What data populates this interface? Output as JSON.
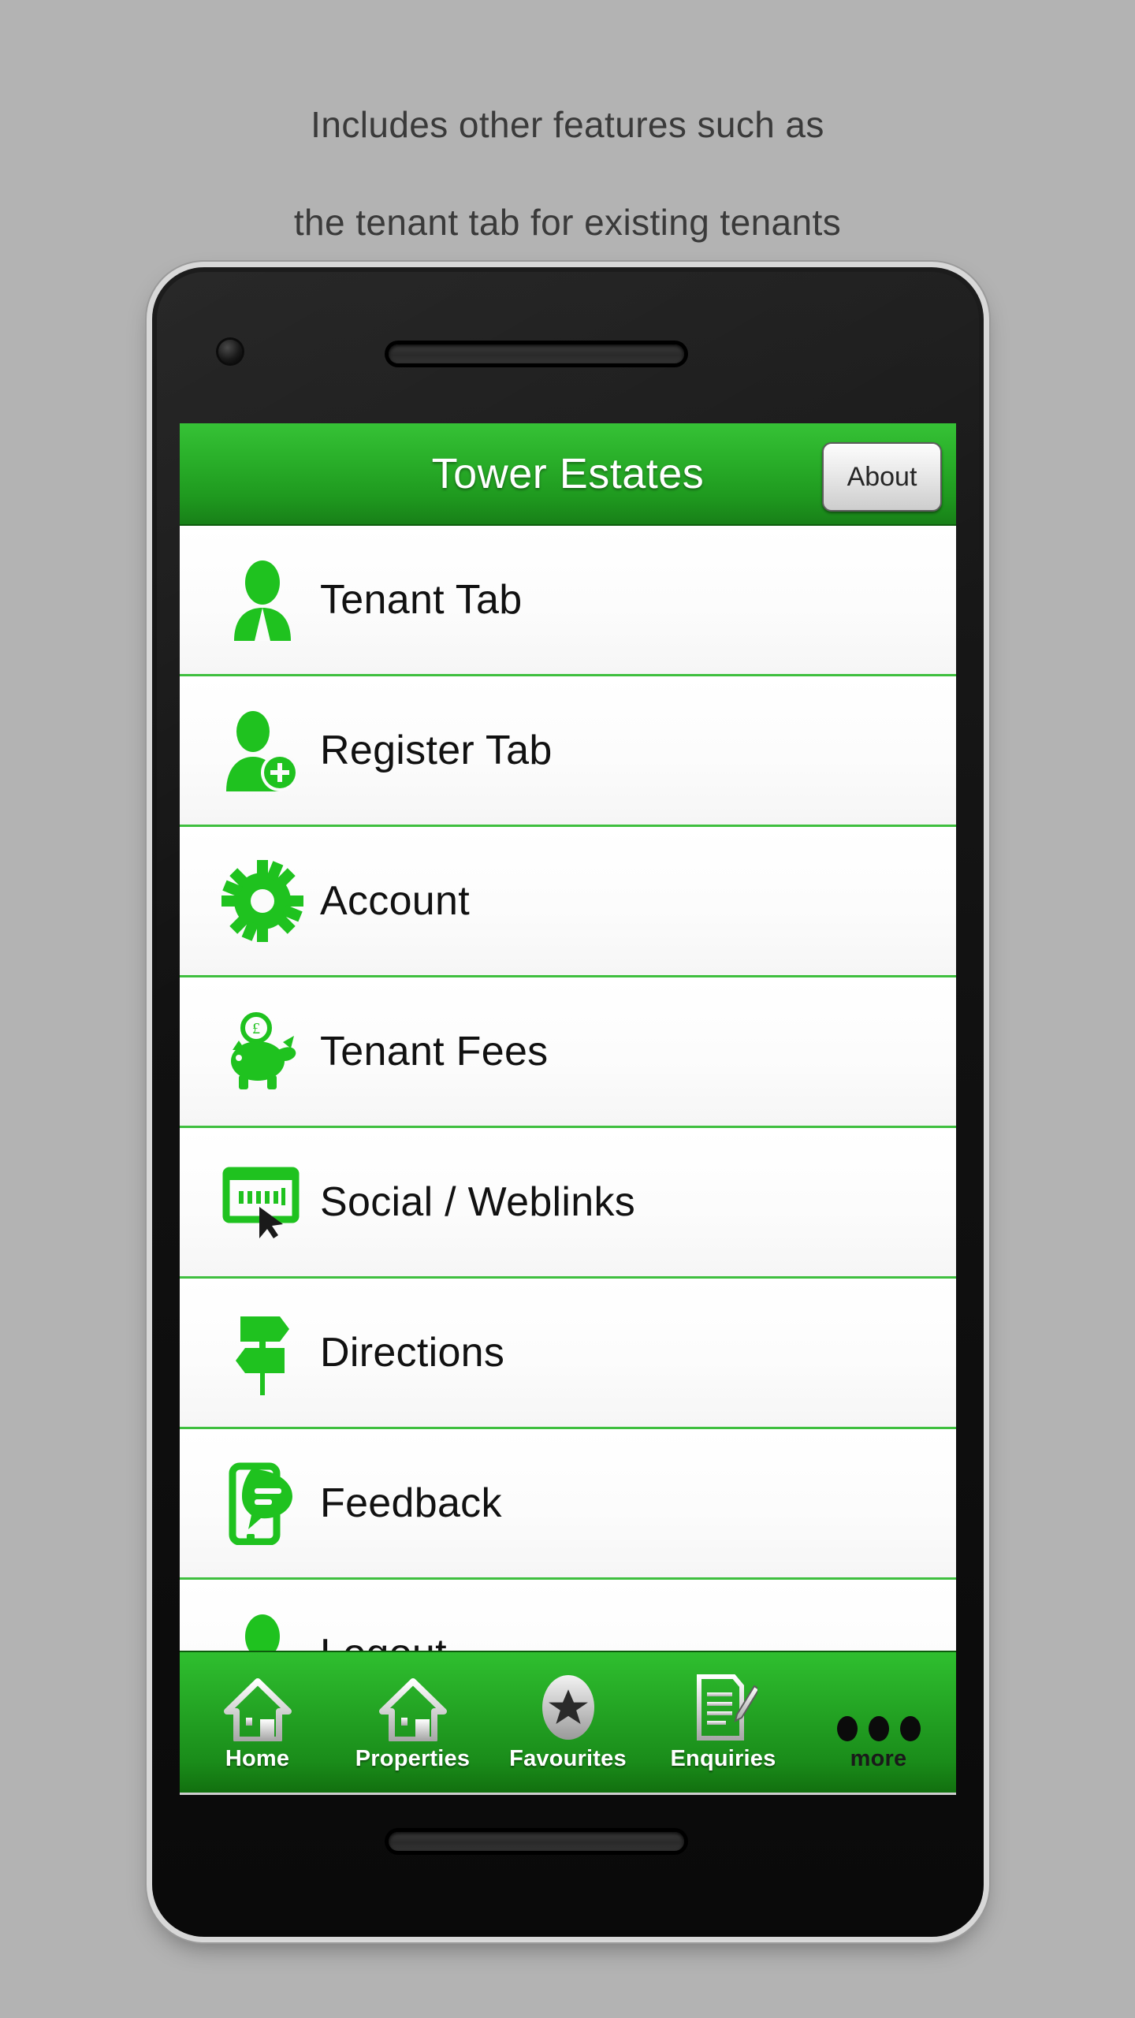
{
  "caption": {
    "line1": "Includes other features such as",
    "line2": "the tenant tab for existing tenants"
  },
  "colors": {
    "page_background": "#b3b3b3",
    "brand_green": "#2ab02a",
    "green_dark": "#188018",
    "separator_green": "#3fbf3f",
    "icon_green": "#1fc21f",
    "list_background": "#fbfbfb",
    "title_text": "#ffffff",
    "caption_text": "#3a3a3a"
  },
  "app": {
    "titlebar": {
      "title": "Tower Estates",
      "about_label": "About"
    },
    "menu": {
      "items": [
        {
          "label": "Tenant Tab",
          "icon": "person-icon"
        },
        {
          "label": "Register Tab",
          "icon": "person-add-icon"
        },
        {
          "label": "Account",
          "icon": "gear-icon"
        },
        {
          "label": "Tenant Fees",
          "icon": "piggy-bank-icon"
        },
        {
          "label": "Social / Weblinks",
          "icon": "browser-window-icon"
        },
        {
          "label": "Directions",
          "icon": "signpost-icon"
        },
        {
          "label": "Feedback",
          "icon": "phone-chat-icon"
        },
        {
          "label": "Logout",
          "icon": "person-icon"
        }
      ]
    },
    "tabbar": {
      "tabs": [
        {
          "label": "Home",
          "icon": "house-icon"
        },
        {
          "label": "Properties",
          "icon": "house-icon"
        },
        {
          "label": "Favourites",
          "icon": "star-oval-icon"
        },
        {
          "label": "Enquiries",
          "icon": "notepad-pen-icon"
        },
        {
          "label": "more",
          "icon": "ellipsis-icon"
        }
      ]
    }
  }
}
